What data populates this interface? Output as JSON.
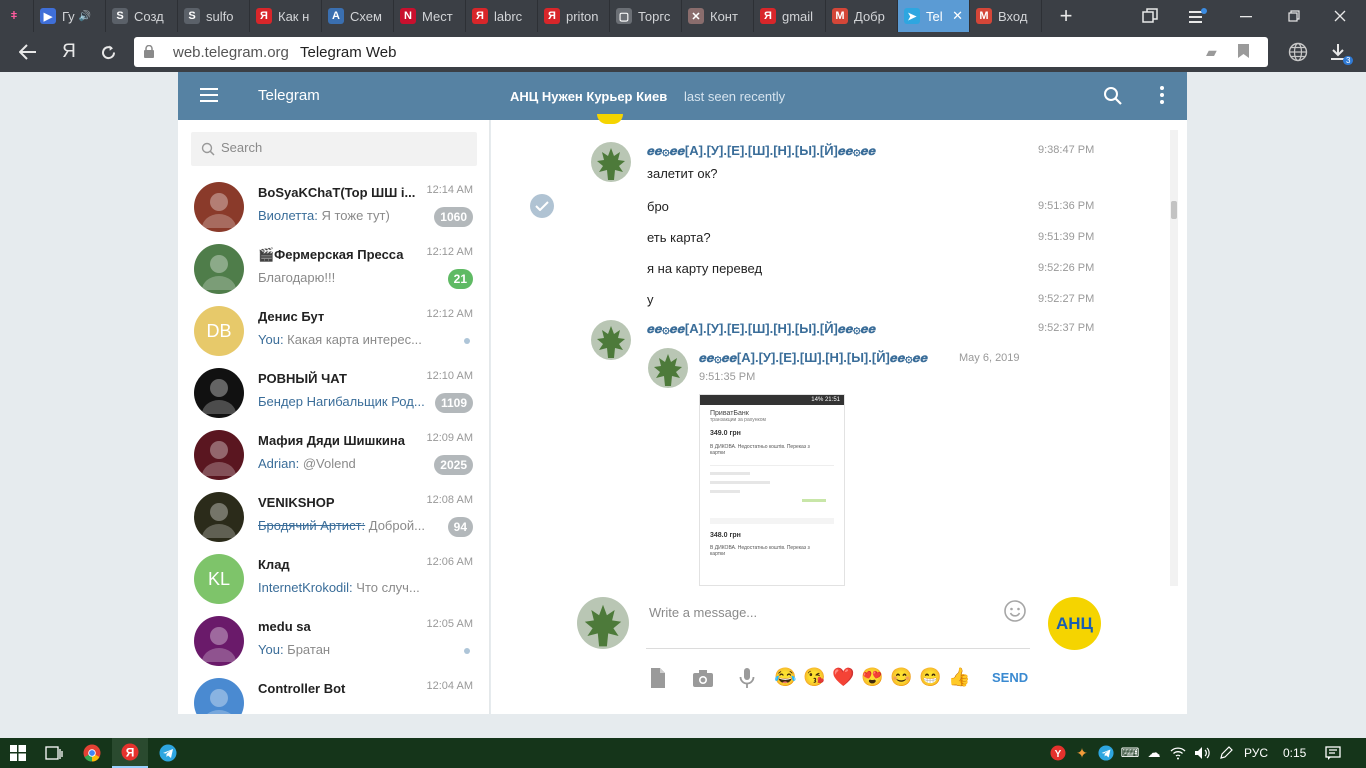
{
  "browser": {
    "tabs": [
      {
        "title": "Гу",
        "color": "#3f6fd8",
        "glyph": "▶",
        "icon": "video-icon",
        "audio": true
      },
      {
        "title": "Созд",
        "color": "#5b6169",
        "glyph": "S",
        "icon": "site-icon"
      },
      {
        "title": "sulfo",
        "color": "#5b6169",
        "glyph": "S",
        "icon": "site-icon"
      },
      {
        "title": "Как н",
        "color": "#d8262a",
        "glyph": "Я",
        "icon": "yandex-icon"
      },
      {
        "title": "Схем",
        "color": "#3a6fb0",
        "glyph": "A",
        "icon": "site-icon"
      },
      {
        "title": "Мест",
        "color": "#c8102e",
        "glyph": "N",
        "icon": "site-icon"
      },
      {
        "title": "labrc",
        "color": "#d8262a",
        "glyph": "Я",
        "icon": "yandex-icon"
      },
      {
        "title": "priton",
        "color": "#d8262a",
        "glyph": "Я",
        "icon": "yandex-icon"
      },
      {
        "title": "Торгс",
        "color": "#6b6f75",
        "glyph": "▢",
        "icon": "page-icon"
      },
      {
        "title": "Конт",
        "color": "#8a6d6d",
        "glyph": "✕",
        "icon": "site-icon"
      },
      {
        "title": "gmail",
        "color": "#d8262a",
        "glyph": "Я",
        "icon": "yandex-icon"
      },
      {
        "title": "Добр",
        "color": "#d44638",
        "glyph": "M",
        "icon": "gmail-icon"
      },
      {
        "title": "Tel",
        "color": "#2ea6e0",
        "glyph": "➤",
        "icon": "telegram-icon",
        "active": true
      },
      {
        "title": "Вход",
        "color": "#d44638",
        "glyph": "M",
        "icon": "gmail-icon"
      }
    ],
    "new_tab": "+",
    "url_domain": "web.telegram.org",
    "page_title": "Telegram Web",
    "downloads_count": "3"
  },
  "telegram": {
    "app_title": "Telegram",
    "peer_name": "АНЦ Нужен Курьер Киев",
    "peer_status": "last seen recently",
    "search_placeholder": "Search",
    "dialogs": [
      {
        "name": "BoSyaKChaT(Top ШШ i...",
        "time": "12:14 AM",
        "from": "Виолетта:",
        "text": " Я тоже тут)",
        "badge": "1060",
        "ava_color": "#8a3a2a"
      },
      {
        "name": "🎬Фермерская Пресса",
        "time": "12:12 AM",
        "from": "",
        "text": "Благодарю!!!",
        "badge": "21",
        "badge_green": true,
        "ava_color": "#4f7d4a"
      },
      {
        "name": "Денис Бут",
        "time": "12:12 AM",
        "from": "You:",
        "text": " Какая карта интерес...",
        "initials": "DB",
        "ava_color": "#e7c96a",
        "dot": true
      },
      {
        "name": "РОВНЫЙ ЧАТ",
        "time": "12:10 AM",
        "from": "Бендер Нагибальщик Род...",
        "text": "",
        "badge": "1109",
        "ava_color": "#111111"
      },
      {
        "name": "Мафия Дяди Шишкина",
        "time": "12:09 AM",
        "from": "Adrian:",
        "text": " @Volend",
        "badge": "2025",
        "ava_color": "#5a1620"
      },
      {
        "name": "VENIKSHOP",
        "time": "12:08 AM",
        "from": "Бродячий Артист:",
        "text": " Доброй...",
        "badge": "94",
        "strike": true,
        "ava_color": "#2b2b1a"
      },
      {
        "name": "Клад",
        "time": "12:06 AM",
        "from": "InternetKrokodil:",
        "text": " Что случ...",
        "initials": "KL",
        "ava_color": "#7ec46a"
      },
      {
        "name": "medu sa",
        "time": "12:05 AM",
        "from": "You:",
        "text": " Братан",
        "ava_color": "#6a1a6a",
        "dot": true
      },
      {
        "name": "Controller Bot",
        "time": "12:04 AM",
        "from": "",
        "text": "",
        "ava_color": "#4a8ad1"
      }
    ],
    "messages": {
      "author": "𝒆𝒆۞𝒆𝒆[А].[У].[Е].[Ш].[Н].[Ы].[Й]𝒆𝒆۞𝒆𝒆",
      "m1_text": "залетит ок?",
      "m1_time": "9:38:47 PM",
      "m2_text": "бро",
      "m2_time": "9:51:36 PM",
      "m3_text": "еть карта?",
      "m3_time": "9:51:39 PM",
      "m4_text": "я на карту перевед",
      "m4_time": "9:52:26 PM",
      "m5_text": "у",
      "m5_time": "9:52:27 PM",
      "m6_time": "9:52:37 PM",
      "fwd_date": "May 6, 2019",
      "fwd_time": "9:51:35 PM"
    },
    "screenshot": {
      "status": "14% 21:51",
      "bank": "ПриватБанк",
      "bank_sub": "транзакции за рахунком",
      "amount1": "349.0 грн",
      "desc1": "В ДИКОВА. Недостатньо коштів. Переказ з картки",
      "amount2": "348.0 грн",
      "desc2": "В ДИКОВА. Недостатньо коштів. Переказ з картки"
    },
    "composer": {
      "placeholder": "Write a message...",
      "send_label": "SEND",
      "peer_logo_text": "АНЦ",
      "emojis": [
        "😂",
        "😘",
        "❤️",
        "😍",
        "😊",
        "😁",
        "👍"
      ]
    }
  },
  "taskbar": {
    "language": "РУС",
    "time": "0:15"
  }
}
